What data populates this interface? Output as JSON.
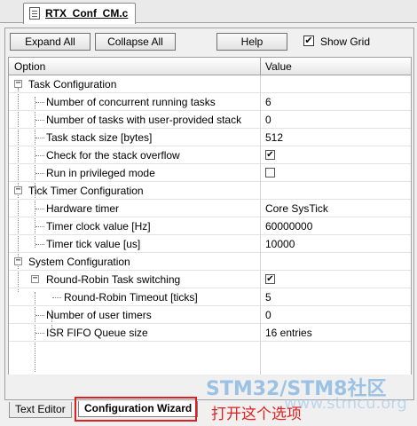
{
  "file_tab": {
    "label": "RTX_Conf_CM.c"
  },
  "toolbar": {
    "expand_all": "Expand All",
    "collapse_all": "Collapse All",
    "help": "Help",
    "show_grid_label": "Show Grid",
    "show_grid_checked": true
  },
  "columns": {
    "option": "Option",
    "value": "Value"
  },
  "groups": [
    {
      "label": "Task Configuration",
      "items": [
        {
          "option": "Number of concurrent running tasks",
          "value": "6"
        },
        {
          "option": "Number of tasks with user-provided stack",
          "value": "0"
        },
        {
          "option": "Task stack size [bytes]",
          "value": "512"
        },
        {
          "option": "Check for the stack overflow",
          "checked": true
        },
        {
          "option": "Run in privileged mode",
          "checked": false
        }
      ]
    },
    {
      "label": "Tick Timer Configuration",
      "items": [
        {
          "option": "Hardware timer",
          "value": "Core SysTick"
        },
        {
          "option": "Timer clock value [Hz]",
          "value": "60000000"
        },
        {
          "option": "Timer tick value [us]",
          "value": "10000"
        }
      ]
    },
    {
      "label": "System Configuration",
      "items": [
        {
          "option": "Round-Robin Task switching",
          "checked": true
        },
        {
          "option": "Round-Robin Timeout [ticks]",
          "value": "5"
        },
        {
          "option": "Number of user timers",
          "value": "0"
        },
        {
          "option": "ISR FIFO Queue size",
          "value": "16 entries"
        }
      ]
    }
  ],
  "bottom_tabs": {
    "text_editor": "Text Editor",
    "config_wizard": "Configuration Wizard"
  },
  "annotation": "打开这个选项",
  "watermark": "STM32/STM8社区",
  "watermark_sub": "www.stmcu.org",
  "colors": {
    "annotation_red": "#e02020",
    "watermark_blue": "#7fb3e0"
  }
}
